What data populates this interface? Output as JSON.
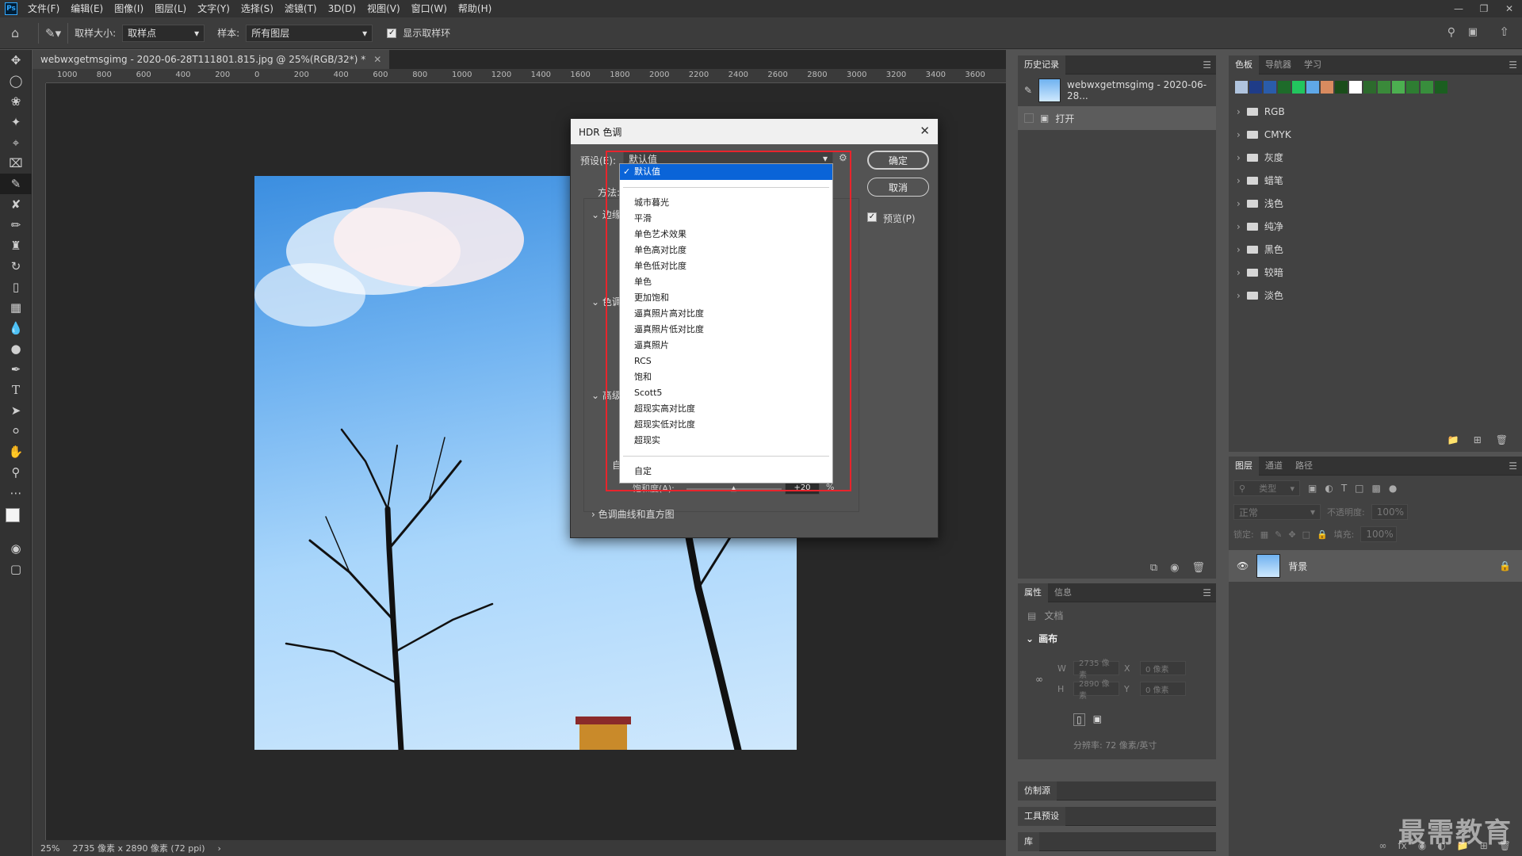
{
  "menubar": {
    "logo": "Ps",
    "items": [
      "文件(F)",
      "编辑(E)",
      "图像(I)",
      "图层(L)",
      "文字(Y)",
      "选择(S)",
      "滤镜(T)",
      "3D(D)",
      "视图(V)",
      "窗口(W)",
      "帮助(H)"
    ]
  },
  "options": {
    "sample_size_label": "取样大小:",
    "sample_size_value": "取样点",
    "sample_label": "样本:",
    "sample_value": "所有图层",
    "show_ring_label": "显示取样环"
  },
  "document": {
    "tab_title": "webwxgetmsgimg - 2020-06-28T111801.815.jpg @ 25%(RGB/32*) *",
    "ruler_ticks": [
      "1000",
      "800",
      "600",
      "400",
      "200",
      "0",
      "200",
      "400",
      "600",
      "800",
      "1000",
      "1200",
      "1400",
      "1600",
      "1800",
      "2000",
      "2200",
      "2400",
      "2600",
      "2800",
      "3000",
      "3200",
      "3400",
      "3600"
    ]
  },
  "status": {
    "zoom": "25%",
    "dims": "2735 像素 x 2890 像素 (72 ppi)"
  },
  "history": {
    "tabs": [
      "历史记录"
    ],
    "snapshot": "webwxgetmsgimg - 2020-06-28...",
    "step": "打开"
  },
  "swatches": {
    "tabs": [
      "色板",
      "导航器",
      "学习"
    ],
    "colors": [
      "#b0c4de",
      "#1f3c88",
      "#2a5caa",
      "#1e6b2a",
      "#22c55e",
      "#5fa8e8",
      "#d98b5f",
      "#1a4d1a",
      "#ffffff",
      "#2d6a2d",
      "#3a8a3a",
      "#4caf50",
      "#2e7d32",
      "#388e3c",
      "#1b5e20"
    ],
    "groups": [
      "RGB",
      "CMYK",
      "灰度",
      "蜡笔",
      "浅色",
      "纯净",
      "黑色",
      "较暗",
      "淡色"
    ]
  },
  "layers": {
    "tabs": [
      "图层",
      "通道",
      "路径"
    ],
    "kind_placeholder": "类型",
    "blend": "正常",
    "opacity_label": "不透明度:",
    "opacity": "100%",
    "lock_label": "锁定:",
    "fill_label": "填充:",
    "fill": "100%",
    "layer_name": "背景"
  },
  "properties": {
    "tabs": [
      "属性",
      "信息"
    ],
    "doc_label": "文档",
    "canvas_label": "画布",
    "w_label": "W",
    "w_value": "2735 像素",
    "h_label": "H",
    "h_value": "2890 像素",
    "x_label": "X",
    "x_value": "0 像素",
    "y_label": "Y",
    "y_value": "0 像素",
    "resolution": "分辨率: 72 像素/英寸"
  },
  "collapsed_panels": [
    "仿制源",
    "工具预设",
    "库"
  ],
  "dialog": {
    "title": "HDR 色调",
    "preset_label": "预设(E):",
    "preset_value": "默认值",
    "method_label": "方法:",
    "ok": "确定",
    "cancel": "取消",
    "preview": "预览(P)",
    "section_partial": [
      "边缘",
      "色调",
      "高级"
    ],
    "auto_partial": "自",
    "saturation_label": "饱和度(A):",
    "saturation_value": "+20",
    "saturation_unit": "%",
    "curve_section": "色调曲线和直方图",
    "preset_options": [
      "默认值",
      "城市暮光",
      "平滑",
      "单色艺术效果",
      "单色高对比度",
      "单色低对比度",
      "单色",
      "更加饱和",
      "逼真照片高对比度",
      "逼真照片低对比度",
      "逼真照片",
      "RCS",
      "饱和",
      "Scott5",
      "超现实高对比度",
      "超现实低对比度",
      "超现实",
      "自定"
    ]
  },
  "watermark": "最需教育"
}
